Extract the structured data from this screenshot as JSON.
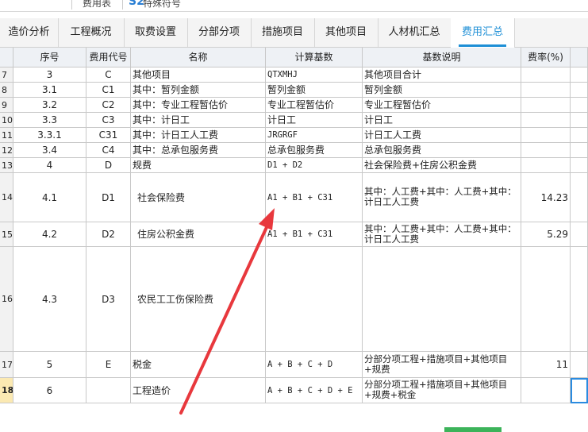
{
  "top_strip": {
    "item1": "费用表",
    "icon": "S2",
    "item2": "特殊符号"
  },
  "tabs": [
    "造价分析",
    "工程概况",
    "取费设置",
    "分部分项",
    "措施项目",
    "其他项目",
    "人材机汇总",
    "费用汇总"
  ],
  "active_tab": "费用汇总",
  "columns": [
    "序号",
    "费用代号",
    "名称",
    "计算基数",
    "基数说明",
    "费率(%)"
  ],
  "rows": [
    {
      "rn": "7",
      "seq": "3",
      "code": "C",
      "name": "其他项目",
      "base": "QTXMHJ",
      "desc": "其他项目合计",
      "rate": ""
    },
    {
      "rn": "8",
      "seq": "3.1",
      "code": "C1",
      "name": "其中：暂列金额",
      "base": "暂列金额",
      "desc": "暂列金额",
      "rate": ""
    },
    {
      "rn": "9",
      "seq": "3.2",
      "code": "C2",
      "name": "其中：专业工程暂估价",
      "base": "专业工程暂估价",
      "desc": "专业工程暂估价",
      "rate": ""
    },
    {
      "rn": "10",
      "seq": "3.3",
      "code": "C3",
      "name": "其中：计日工",
      "base": "计日工",
      "desc": "计日工",
      "rate": ""
    },
    {
      "rn": "11",
      "seq": "3.3.1",
      "code": "C31",
      "name": "其中：计日工人工费",
      "base": "JRGRGF",
      "desc": "计日工人工费",
      "rate": ""
    },
    {
      "rn": "12",
      "seq": "3.4",
      "code": "C4",
      "name": "其中：总承包服务费",
      "base": "总承包服务费",
      "desc": "总承包服务费",
      "rate": ""
    },
    {
      "rn": "13",
      "seq": "4",
      "code": "D",
      "name": "规费",
      "base": "D1 + D2",
      "desc": "社会保险费+住房公积金费",
      "rate": ""
    },
    {
      "rn": "14",
      "seq": "4.1",
      "code": "D1",
      "name": "社会保险费",
      "base": "A1 + B1 + C31",
      "desc": "其中：人工费+其中：人工费+其中：计日工人工费",
      "rate": "14.23"
    },
    {
      "rn": "15",
      "seq": "4.2",
      "code": "D2",
      "name": "住房公积金费",
      "base": "A1 + B1 + C31",
      "desc": "其中：人工费+其中：人工费+其中：计日工人工费",
      "rate": "5.29"
    },
    {
      "rn": "16",
      "seq": "4.3",
      "code": "D3",
      "name": "农民工工伤保险费",
      "base": "",
      "desc": "",
      "rate": ""
    },
    {
      "rn": "17",
      "seq": "5",
      "code": "E",
      "name": "税金",
      "base": "A + B + C + D",
      "desc": "分部分项工程+措施项目+其他项目+规费",
      "rate": "11"
    },
    {
      "rn": "18",
      "seq": "6",
      "code": "",
      "name": "工程造价",
      "base": "A + B + C + D + E",
      "desc": "分部分项工程+措施项目+其他项目+规费+税金",
      "rate": ""
    }
  ],
  "colors": {
    "accent": "#1e8fd6",
    "arrow": "#e8383d",
    "header_bg": "#eef1f5",
    "selected_row": "#fbe9b2"
  }
}
